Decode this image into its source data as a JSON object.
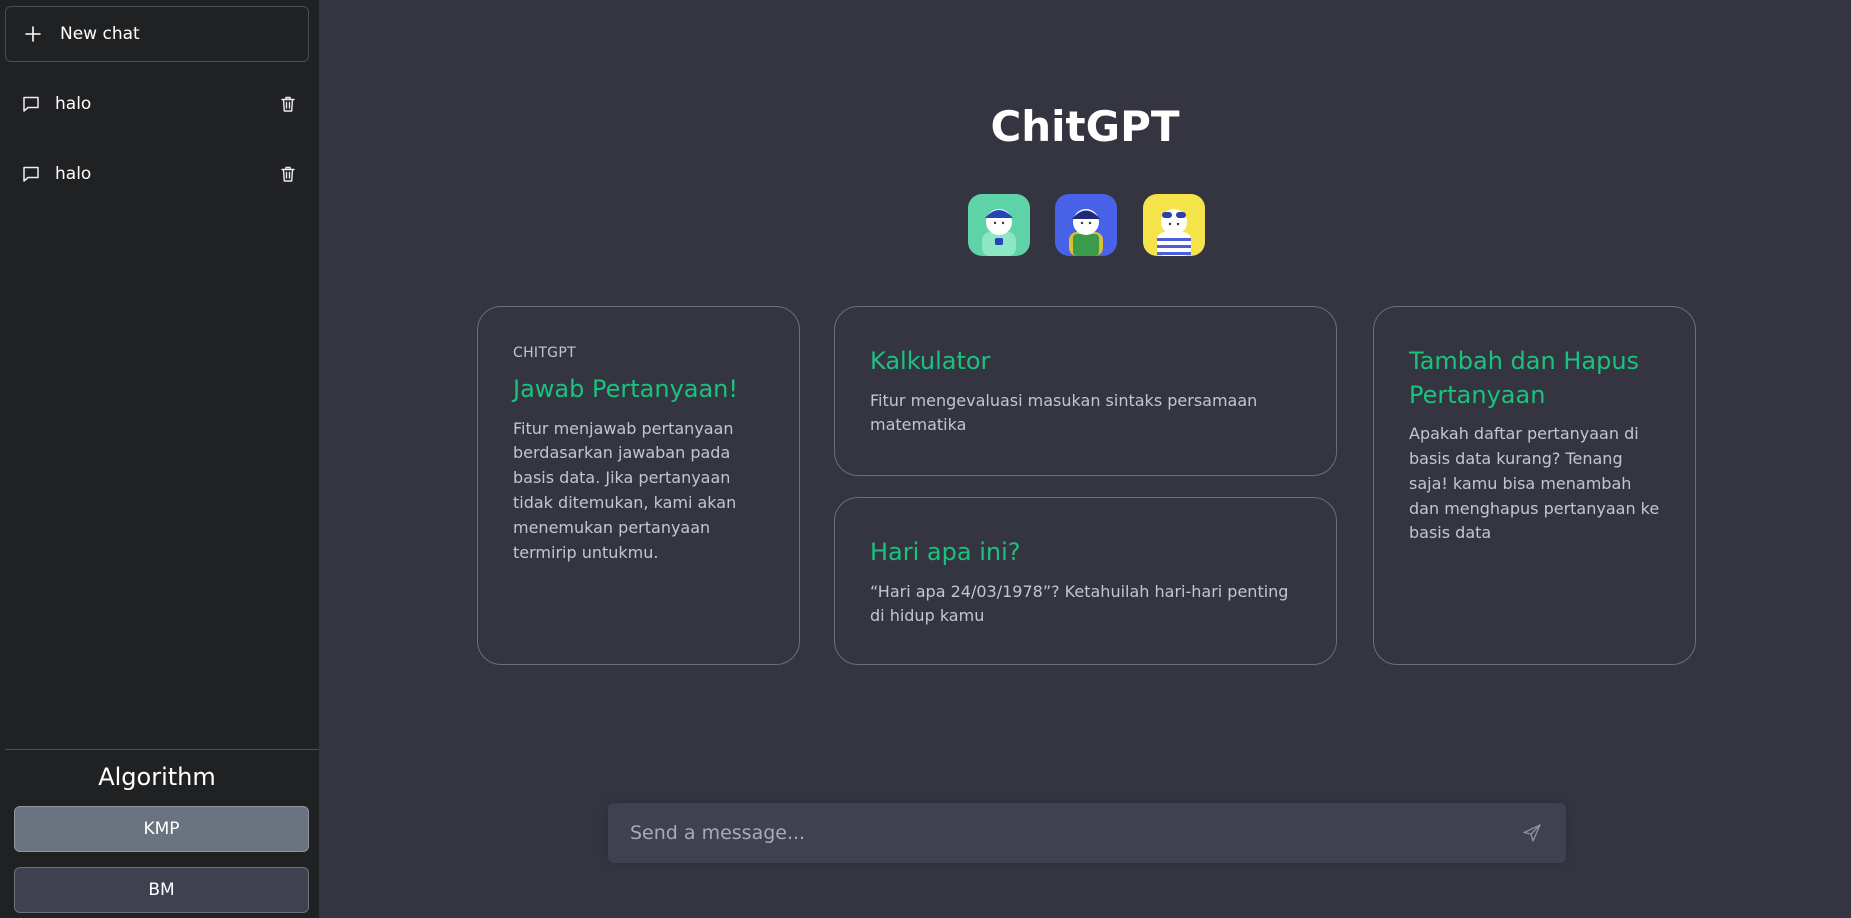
{
  "sidebar": {
    "new_chat_label": "New chat",
    "chats": [
      {
        "label": "halo"
      },
      {
        "label": "halo"
      }
    ],
    "algorithm_title": "Algorithm",
    "algorithm_options": [
      {
        "label": "KMP",
        "selected": true
      },
      {
        "label": "BM",
        "selected": false
      }
    ]
  },
  "main": {
    "title": "ChitGPT",
    "avatars": [
      {
        "name": "avatar-green-icon",
        "bg": "#5ed3a8"
      },
      {
        "name": "avatar-blue-icon",
        "bg": "#4863e8"
      },
      {
        "name": "avatar-yellow-icon",
        "bg": "#f5e34a"
      }
    ],
    "cards": [
      {
        "eyebrow": "CHITGPT",
        "title": "Jawab Pertanyaan!",
        "desc": "Fitur menjawab pertanyaan berdasarkan jawaban pada basis data. Jika pertanyaan tidak ditemukan, kami akan menemukan pertanyaan termirip untukmu."
      },
      {
        "title": "Kalkulator",
        "desc": "Fitur mengevaluasi masukan sintaks persamaan matematika"
      },
      {
        "title": "Hari apa ini?",
        "desc": "“Hari apa 24/03/1978”? Ketahuilah hari-hari penting di hidup kamu"
      },
      {
        "title": "Tambah dan Hapus Pertanyaan",
        "desc": "Apakah daftar pertanyaan di basis data kurang? Tenang saja! kamu bisa menambah dan menghapus pertanyaan ke basis data"
      }
    ],
    "input": {
      "placeholder": "Send a message...",
      "value": ""
    }
  },
  "colors": {
    "sidebar_bg": "#202123",
    "main_bg": "#343541",
    "accent": "#19c37d",
    "input_bg": "#40414f",
    "kmp_selected_bg": "#6b7280"
  }
}
